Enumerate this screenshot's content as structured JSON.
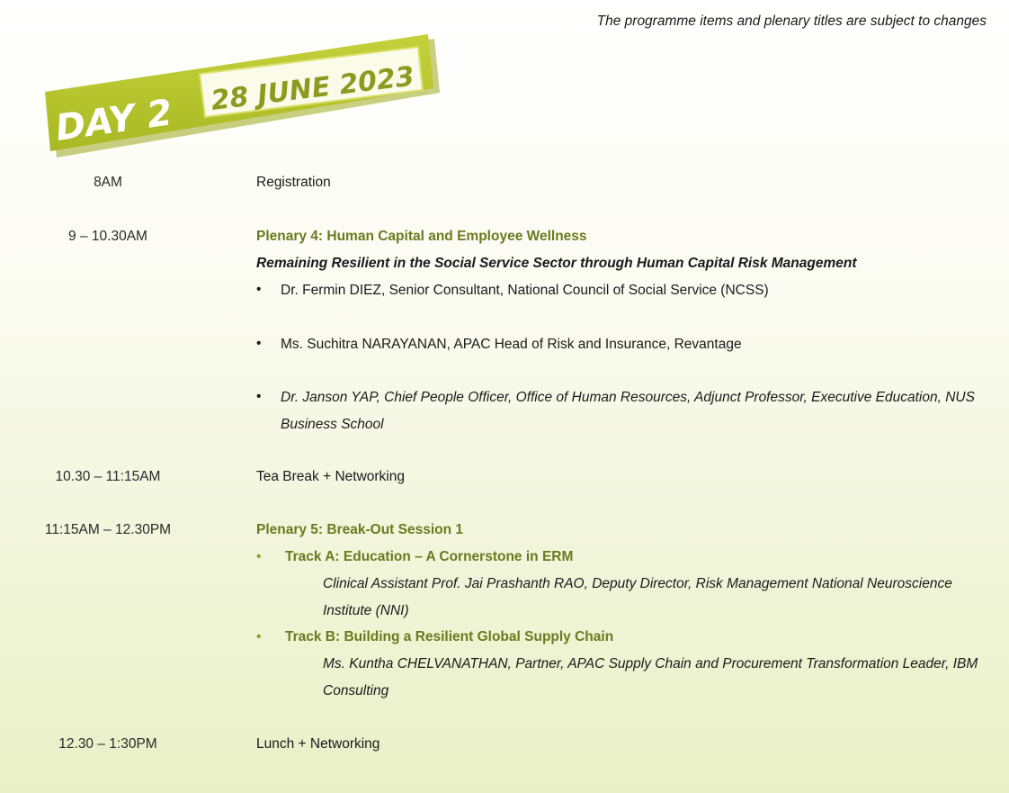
{
  "notice": "The programme items and plenary titles are subject to changes",
  "banner": {
    "day": "DAY 2",
    "date": "28 JUNE 2023",
    "accent": "#b8c62a"
  },
  "schedule": {
    "reg_time": "8AM",
    "reg_text": "Registration",
    "p4_time": "9 – 10.30AM",
    "p4_title": "Plenary 4: Human Capital and Employee Wellness",
    "p4_subtitle": "Remaining Resilient in the Social Service Sector through Human Capital Risk Management",
    "p4_speaker1": "Dr. Fermin DIEZ, Senior Consultant, National Council of Social Service (NCSS)",
    "p4_speaker2": "Ms. Suchitra NARAYANAN, APAC Head of Risk and Insurance, Revantage",
    "p4_speaker3": "Dr. Janson YAP, Chief People Officer, Office of Human Resources, Adjunct Professor, Executive Education, NUS Business School",
    "tea_time": "10.30 – 11:15AM",
    "tea_text": "Tea Break + Networking",
    "p5_time": "11:15AM – 12.30PM",
    "p5_title": "Plenary 5: Break-Out Session 1",
    "trackA_title": "Track A: Education – A Cornerstone in ERM",
    "trackA_speaker": "Clinical Assistant Prof. Jai Prashanth RAO, Deputy Director, Risk Management National Neuroscience Institute (NNI)",
    "trackB_title": "Track B: Building a Resilient Global Supply Chain",
    "trackB_speaker": "Ms. Kuntha CHELVANATHAN, Partner, APAC Supply Chain and Procurement Transformation Leader, IBM Consulting",
    "lunch_time": "12.30 – 1:30PM",
    "lunch_text": "Lunch + Networking",
    "bullet": "•"
  }
}
